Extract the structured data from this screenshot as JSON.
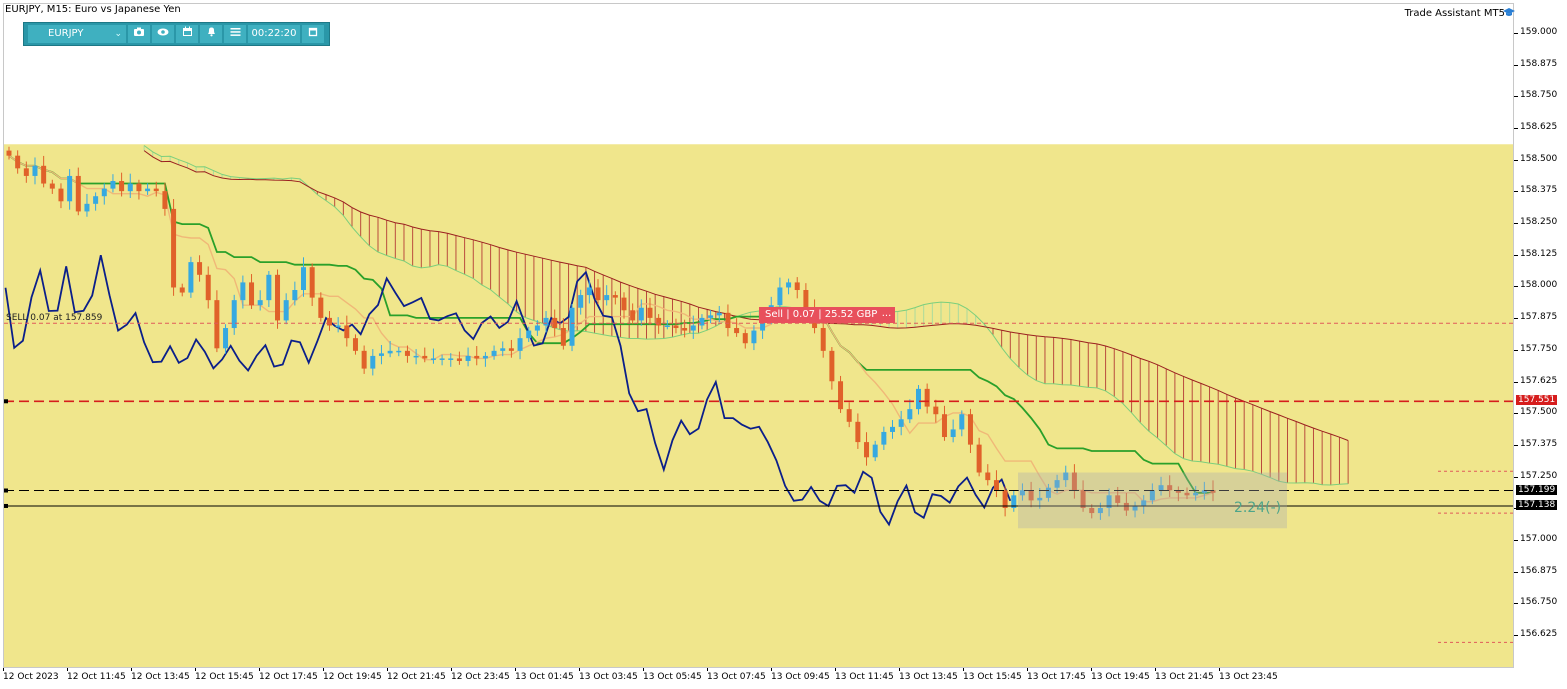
{
  "symbol_title": "EURJPY, M15:  Euro vs Japanese Yen",
  "assistant_label": "Trade Assistant MT5",
  "assistant_icon": "graduation-cap-icon",
  "toolbar": {
    "symbol": "EURJPY",
    "timer": "00:22:20",
    "buttons": [
      "camera-icon",
      "eye-icon",
      "calendar-icon",
      "bell-icon",
      "menu-icon",
      "window-icon"
    ]
  },
  "trade": {
    "sell_label": "Sell | 0.07 | 25.52 GBP",
    "more_label": "...",
    "position_label": "SELL 0.07 at 157.859",
    "risk_reward": "2.24(-)"
  },
  "price_tags": [
    {
      "text": "157.551",
      "price": 157.551,
      "color": "#d61d1d"
    },
    {
      "text": "157.199",
      "price": 157.199,
      "color": "#000000"
    },
    {
      "text": "157.138",
      "price": 157.138,
      "color": "#000000"
    }
  ],
  "colors": {
    "zone": "#f0e68c",
    "bull": "#36a9e1",
    "bear": "#e0612a",
    "ichimoku_green": "#2aa02a",
    "ichimoku_red": "#a01c1c",
    "navy_line": "#0b1f8a"
  },
  "chart_data": {
    "type": "candlestick",
    "symbol": "EURJPY",
    "timeframe": "M15",
    "y_ticks": [
      "159.000",
      "158.875",
      "158.750",
      "158.625",
      "158.500",
      "158.375",
      "158.250",
      "158.125",
      "158.000",
      "157.875",
      "157.750",
      "157.625",
      "157.500",
      "157.375",
      "157.250",
      "157.125",
      "157.000",
      "156.875",
      "156.750",
      "156.625"
    ],
    "ylim": [
      156.562,
      159.047
    ],
    "x_ticks": [
      "12 Oct 2023",
      "12 Oct 11:45",
      "12 Oct 13:45",
      "12 Oct 15:45",
      "12 Oct 17:45",
      "12 Oct 19:45",
      "12 Oct 21:45",
      "12 Oct 23:45",
      "13 Oct 01:45",
      "13 Oct 03:45",
      "13 Oct 05:45",
      "13 Oct 07:45",
      "13 Oct 09:45",
      "13 Oct 11:45",
      "13 Oct 13:45",
      "13 Oct 15:45",
      "13 Oct 17:45",
      "13 Oct 19:45",
      "13 Oct 21:45",
      "13 Oct 23:45"
    ],
    "zone_price_range": [
      156.562,
      158.565
    ],
    "horizontal_lines": [
      {
        "price": 157.551,
        "style": "dashed",
        "color": "#d61d1d"
      },
      {
        "price": 157.199,
        "style": "dashed",
        "color": "#000000"
      },
      {
        "price": 157.138,
        "style": "solid",
        "color": "#000000"
      },
      {
        "price": 157.859,
        "style": "dashed",
        "color": "#e05a5a"
      }
    ],
    "closes": [
      158.52,
      158.47,
      158.44,
      158.48,
      158.41,
      158.39,
      158.34,
      158.44,
      158.3,
      158.33,
      158.36,
      158.39,
      158.42,
      158.38,
      158.41,
      158.38,
      158.39,
      158.38,
      158.31,
      158.0,
      157.98,
      158.1,
      158.05,
      157.95,
      157.76,
      157.84,
      157.95,
      158.02,
      157.93,
      157.95,
      158.05,
      157.87,
      157.95,
      157.99,
      158.08,
      157.96,
      157.88,
      157.85,
      157.85,
      157.8,
      157.75,
      157.68,
      157.73,
      157.74,
      157.75,
      157.75,
      157.73,
      157.73,
      157.72,
      157.72,
      157.72,
      157.72,
      157.71,
      157.73,
      157.72,
      157.73,
      157.75,
      157.76,
      157.75,
      157.8,
      157.83,
      157.85,
      157.88,
      157.84,
      157.77,
      157.92,
      157.97,
      158.0,
      157.95,
      157.97,
      157.96,
      157.91,
      157.87,
      157.92,
      157.88,
      157.85,
      157.85,
      157.84,
      157.83,
      157.85,
      157.88,
      157.89,
      157.9,
      157.84,
      157.82,
      157.78,
      157.83,
      157.87,
      157.93,
      158.0,
      158.02,
      157.99,
      157.92,
      157.84,
      157.75,
      157.63,
      157.52,
      157.47,
      157.39,
      157.33,
      157.38,
      157.43,
      157.45,
      157.48,
      157.52,
      157.6,
      157.53,
      157.5,
      157.41,
      157.44,
      157.5,
      157.38,
      157.27,
      157.24,
      157.2,
      157.13,
      157.18,
      157.2,
      157.16,
      157.17,
      157.21,
      157.24,
      157.27,
      157.2,
      157.13,
      157.11,
      157.13,
      157.18,
      157.15,
      157.12,
      157.14,
      157.16,
      157.2,
      157.22,
      157.2,
      157.19,
      157.18,
      157.19,
      157.2,
      157.19
    ]
  }
}
